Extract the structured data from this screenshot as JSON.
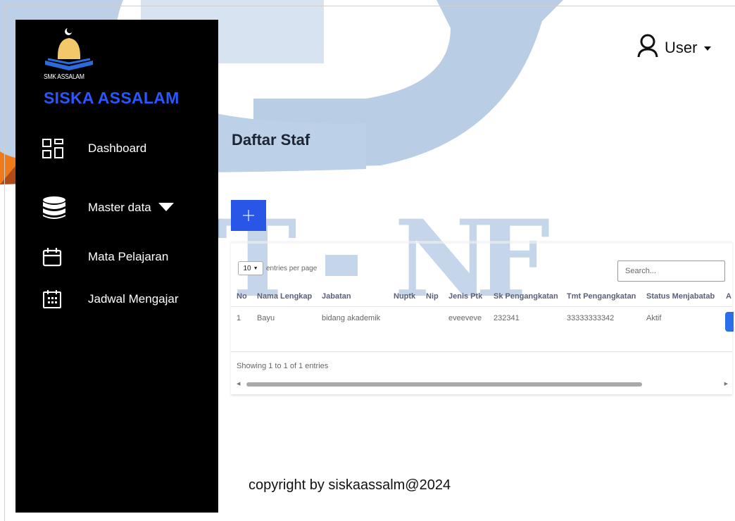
{
  "sidebar": {
    "logo_caption": "SMK ASSALAM",
    "brand": "SISKA ASSALAM",
    "items": [
      {
        "label": "Dashboard",
        "icon": "dashboard-grid-icon"
      },
      {
        "label": "Master data",
        "icon": "database-icon"
      },
      {
        "label": "Mata Pelajaran",
        "icon": "calendar-icon"
      },
      {
        "label": "Jadwal Mengajar",
        "icon": "calendar-grid-icon"
      }
    ]
  },
  "header": {
    "user_label": "User"
  },
  "page": {
    "title": "Daftar Staf",
    "add_icon": "plus-icon"
  },
  "table": {
    "per_page_value": "10",
    "per_page_label": "entries per page",
    "search_placeholder": "Search...",
    "columns": [
      "No",
      "Nama Lengkap",
      "Jabatan",
      "Nuptk",
      "Nip",
      "Jenis Ptk",
      "Sk Pengangkatan",
      "Tmt Pengangkatan",
      "Status Menjabatab",
      "A"
    ],
    "rows": [
      [
        "1",
        "Bayu",
        "bidang akademik",
        "",
        "",
        "eveeveve",
        "232341",
        "33333333342",
        "Aktif"
      ]
    ],
    "info": "Showing 1 to 1 of 1 entries"
  },
  "footer": {
    "copyright": "copyright by siskaassalm@2024"
  },
  "colors": {
    "brand": "#2a56ff",
    "accent": "#2a56e8",
    "sidebar_bg": "#000000"
  }
}
